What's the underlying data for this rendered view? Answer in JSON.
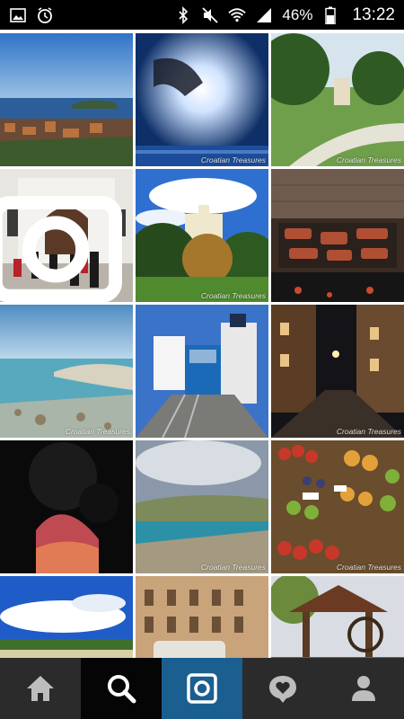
{
  "status_bar": {
    "battery": "46%",
    "time": "13:22",
    "left_icons": [
      "gallery-icon",
      "alarm-icon"
    ],
    "right_icons": [
      "bluetooth-icon",
      "mute-icon",
      "wifi-icon",
      "signal-icon",
      "battery-icon"
    ]
  },
  "grid": {
    "watermark": "Croatian Treasures",
    "items": [
      {
        "subject": "coastal town with islands"
      },
      {
        "subject": "hand holding the sun"
      },
      {
        "subject": "park with tree-lined path"
      },
      {
        "subject": "church facade with guards"
      },
      {
        "subject": "castle on green hill"
      },
      {
        "subject": "meat on grill"
      },
      {
        "subject": "rocky clear sea shore"
      },
      {
        "subject": "funicular and tower"
      },
      {
        "subject": "old town street at night"
      },
      {
        "subject": "sunset through trees"
      },
      {
        "subject": "bay with island landscape"
      },
      {
        "subject": "fruit market stalls"
      },
      {
        "subject": "blue sky clouds and beach"
      },
      {
        "subject": "old building with vintage car"
      },
      {
        "subject": "wooden well in garden"
      }
    ]
  },
  "nav": {
    "items": [
      {
        "icon": "home-icon"
      },
      {
        "icon": "search-icon",
        "active": true
      },
      {
        "icon": "camera-icon"
      },
      {
        "icon": "activity-icon"
      },
      {
        "icon": "profile-icon"
      }
    ]
  },
  "colors": {
    "nav_bg": "#2b2b2b",
    "nav_active": "#050505",
    "camera_accent": "#1a5f90",
    "status_bg": "#000000"
  }
}
